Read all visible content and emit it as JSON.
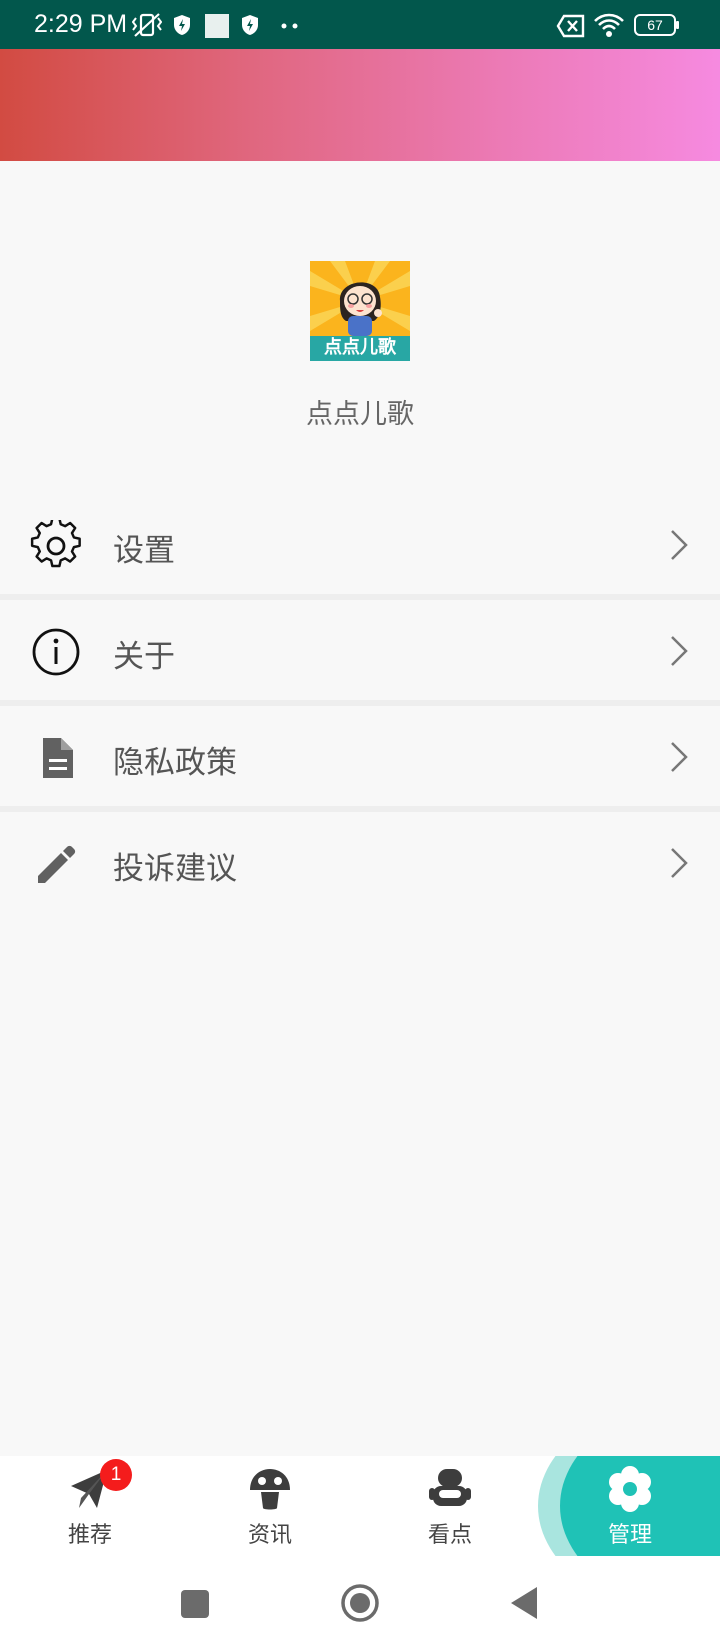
{
  "status_bar": {
    "time": "2:29 PM",
    "battery": "67",
    "icons": [
      "vibrate-off-icon",
      "shield-icon",
      "square-icon",
      "shield-icon",
      "more-dots-icon",
      "sim-x-icon",
      "wifi-icon",
      "battery-icon"
    ]
  },
  "app": {
    "name": "点点儿歌",
    "logo_text": "点点儿歌"
  },
  "menu": [
    {
      "label": "设置",
      "icon": "gear-icon"
    },
    {
      "label": "关于",
      "icon": "info-icon"
    },
    {
      "label": "隐私政策",
      "icon": "document-icon"
    },
    {
      "label": "投诉建议",
      "icon": "pencil-icon"
    }
  ],
  "bottom_nav": [
    {
      "label": "推荐",
      "icon": "paper-plane-icon",
      "badge": "1"
    },
    {
      "label": "资讯",
      "icon": "mushroom-icon"
    },
    {
      "label": "看点",
      "icon": "robot-icon"
    },
    {
      "label": "管理",
      "icon": "flower-gear-icon",
      "active": true
    }
  ],
  "colors": {
    "accent": "#1fc2b6",
    "status_bar": "#02574c",
    "banner_start": "#d24b42",
    "banner_end": "#f68ae0",
    "badge": "#f41c1c"
  }
}
